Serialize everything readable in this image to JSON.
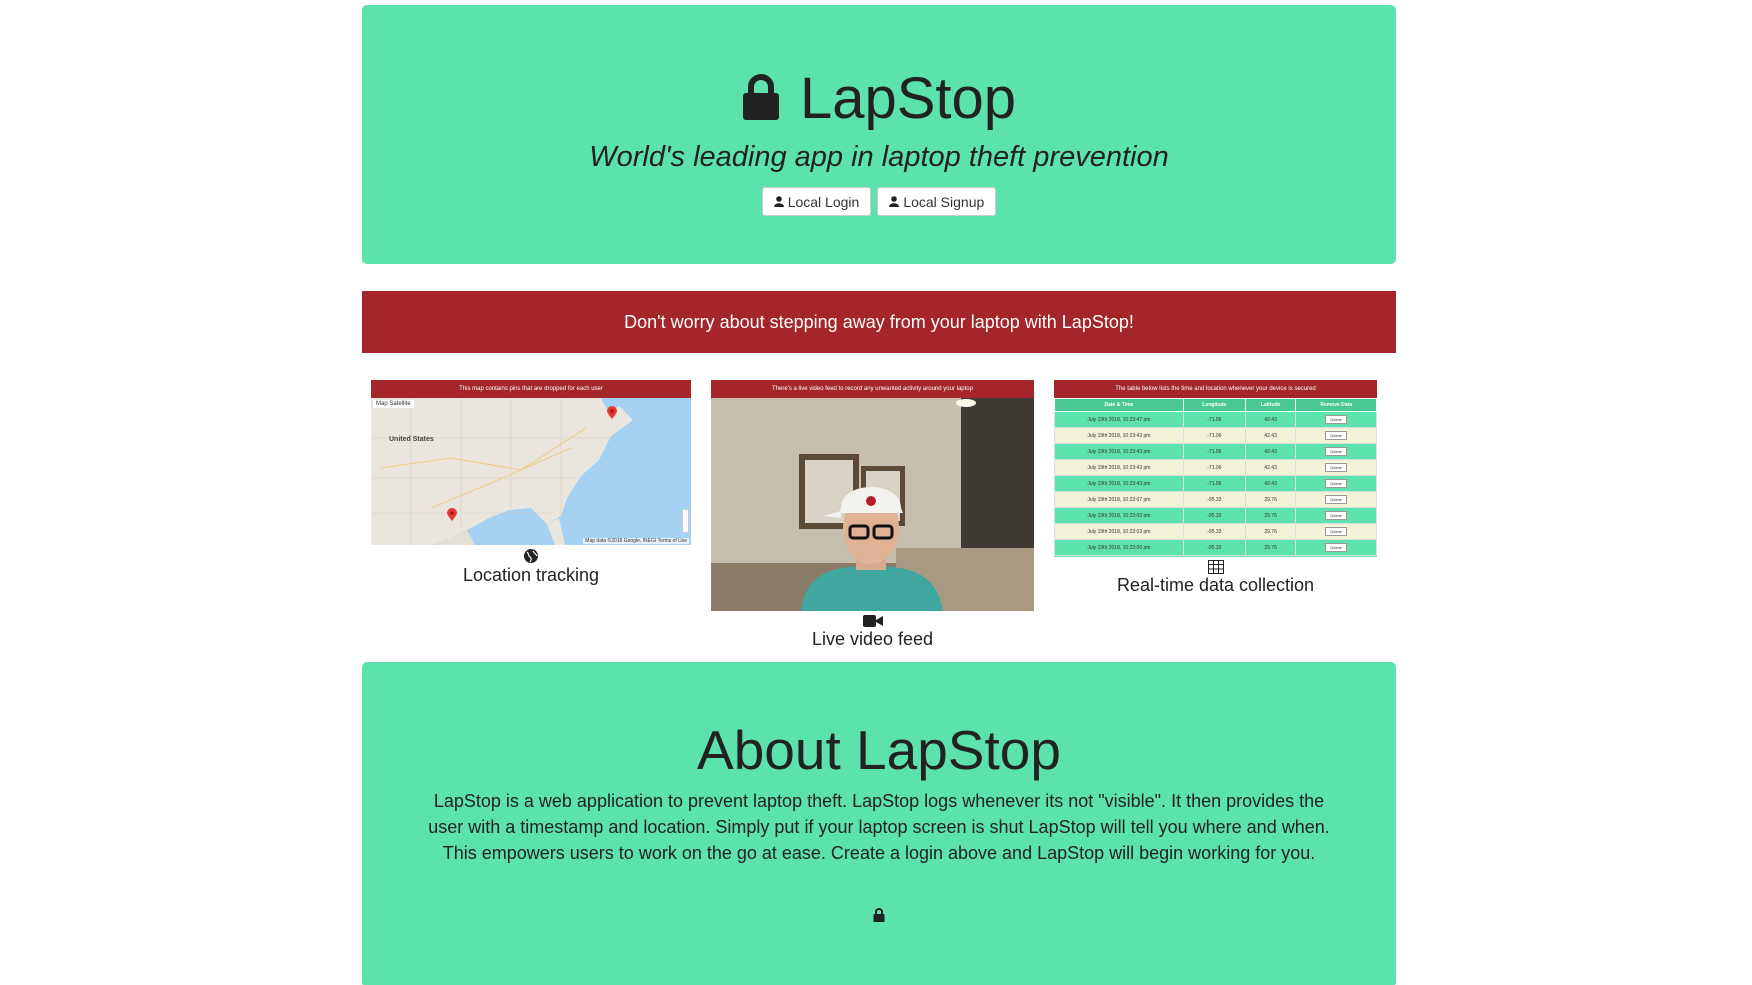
{
  "hero": {
    "title": "LapStop",
    "subtitle": "World's leading app in laptop theft prevention",
    "login_label": "Local Login",
    "signup_label": "Local Signup"
  },
  "banner": {
    "text": "Don't worry about stepping away from your laptop with LapStop!"
  },
  "features": {
    "map": {
      "header": "This map contains pins that are dropped for each user",
      "tab_map": "Map",
      "tab_satellite": "Satellite",
      "region_label": "United States",
      "credit": "Map data ©2018 Google, INEGI   Terms of Use",
      "label": "Location tracking"
    },
    "video": {
      "header": "There's a live video feed to record any unwanted activity around your laptop",
      "label": "Live video feed"
    },
    "table": {
      "header": "The table below lists the time and location whenever your device is secured",
      "columns": [
        "Date & Time",
        "Longitude",
        "Latitude",
        "Remove Data"
      ],
      "rows": [
        [
          "July 19th 2018, 10:23:47 pm",
          "-71.06",
          "42.43",
          "Delete"
        ],
        [
          "July 19th 2018, 10:23:43 pm",
          "-71.06",
          "42.43",
          "Delete"
        ],
        [
          "July 19th 2018, 10:23:43 pm",
          "-71.06",
          "42.43",
          "Delete"
        ],
        [
          "July 19th 2018, 10:23:43 pm",
          "-71.06",
          "42.43",
          "Delete"
        ],
        [
          "July 19th 2018, 10:23:43 pm",
          "-71.06",
          "42.43",
          "Delete"
        ],
        [
          "July 19th 2018, 10:22:07 pm",
          "-95.33",
          "29.76",
          "Delete"
        ],
        [
          "July 19th 2018, 10:22:03 pm",
          "-95.33",
          "29.76",
          "Delete"
        ],
        [
          "July 19th 2018, 10:22:03 pm",
          "-95.33",
          "29.76",
          "Delete"
        ],
        [
          "July 19th 2018, 10:22:00 pm",
          "-95.33",
          "29.76",
          "Delete"
        ]
      ],
      "label": "Real-time data collection"
    }
  },
  "about": {
    "title": "About LapStop",
    "text": "LapStop is a web application to prevent laptop theft. LapStop logs whenever its not \"visible\". It then provides the user with a timestamp and location. Simply put if your laptop screen is shut LapStop will tell you where and when. This empowers users to work on the go at ease. Create a login above and LapStop will begin working for you."
  },
  "colors": {
    "green": "#5ce3ad",
    "red": "#a4262a",
    "text": "#222222"
  },
  "icons": [
    "lock-icon",
    "user-icon",
    "globe-icon",
    "video-camera-icon",
    "table-icon",
    "map-pin-icon"
  ]
}
